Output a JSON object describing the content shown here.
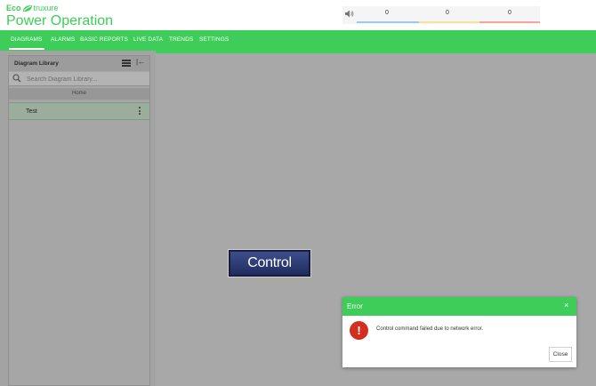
{
  "brand": {
    "top_line_prefix": "Eco",
    "top_line_suffix": "truxure",
    "product_name": "Power Operation",
    "color": "#3dcd58"
  },
  "alarm_summary": {
    "icon": "speaker-icon",
    "counts": [
      "0",
      "0",
      "0"
    ],
    "colors": [
      "#9ec9ee",
      "#f5e39a",
      "#f0a7a0"
    ]
  },
  "nav": {
    "items": [
      "DIAGRAMS",
      "ALARMS",
      "BASIC REPORTS",
      "LIVE DATA",
      "TRENDS",
      "SETTINGS"
    ],
    "active": "DIAGRAMS"
  },
  "sidebar": {
    "title": "Diagram Library",
    "menu_icon": "hamburger-icon",
    "collapse_icon": "collapse-left-icon",
    "search_placeholder": "Search Diagram Library...",
    "section": "Home",
    "items": [
      {
        "label": "Test"
      }
    ]
  },
  "canvas": {
    "control_button": "Control"
  },
  "dialog": {
    "title": "Error",
    "close_symbol": "×",
    "icon": "error-icon",
    "icon_glyph": "!",
    "message": "Control command failed due to network error.",
    "close_button": "Close"
  }
}
